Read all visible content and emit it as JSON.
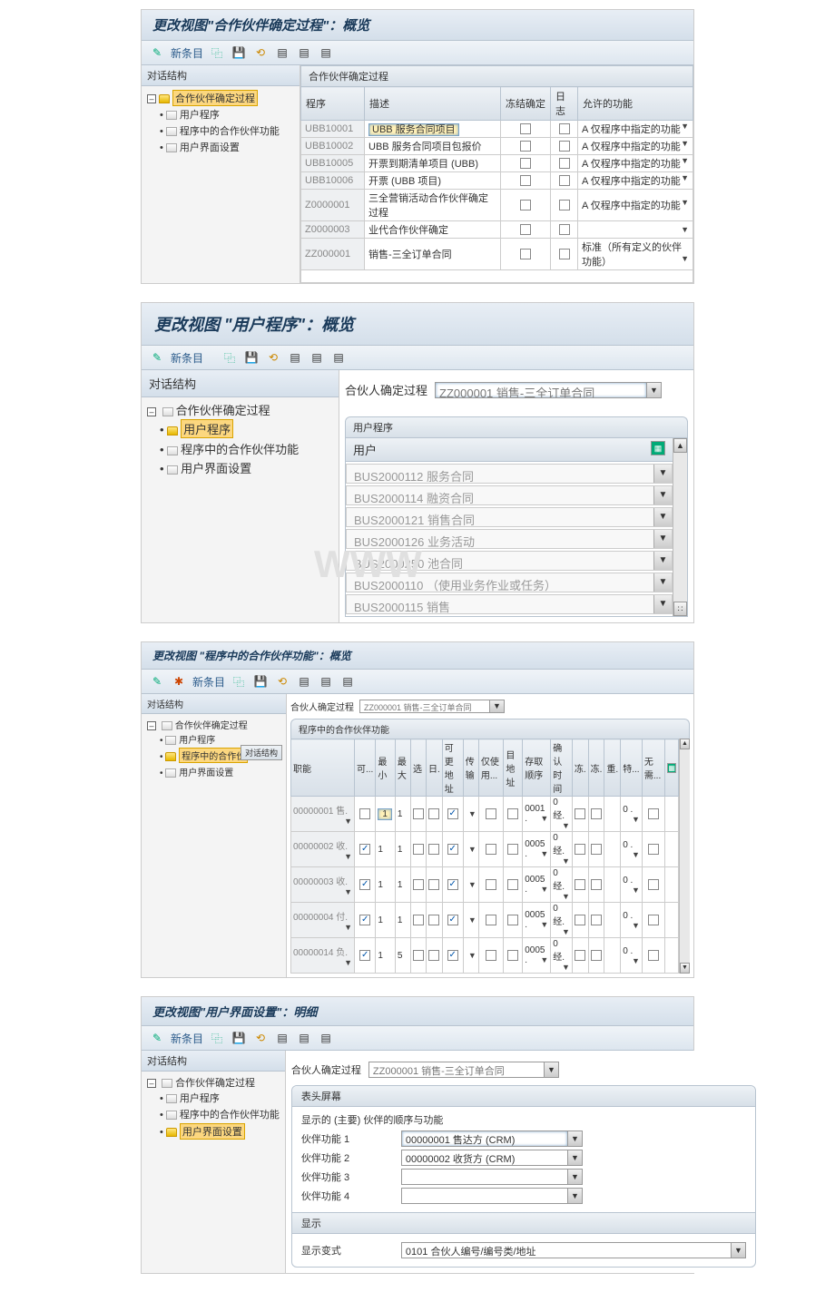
{
  "panel1": {
    "title": "更改视图\"合作伙伴确定过程\"：概览",
    "toolbar_new": "新条目",
    "sidebar_head": "对话结构",
    "tree_root": "合作伙伴确定过程",
    "tree_items": [
      "用户程序",
      "程序中的合作伙伴功能",
      "用户界面设置"
    ],
    "grid_title": "合作伙伴确定过程",
    "columns": {
      "c1": "程序",
      "c2": "描述",
      "c3": "冻结确定",
      "c4": "日志",
      "c5": "允许的功能"
    },
    "rows": [
      {
        "code": "UBB10001",
        "desc": "UBB 服务合同项目",
        "func": "A 仅程序中指定的功能",
        "hl": true
      },
      {
        "code": "UBB10002",
        "desc": "UBB 服务合同项目包报价",
        "func": "A 仅程序中指定的功能"
      },
      {
        "code": "UBB10005",
        "desc": "开票到期清单项目 (UBB)",
        "func": "A 仅程序中指定的功能"
      },
      {
        "code": "UBB10006",
        "desc": "开票 (UBB 项目)",
        "func": "A 仅程序中指定的功能"
      },
      {
        "code": "Z0000001",
        "desc": "三全营销活动合作伙伴确定过程",
        "func": "A 仅程序中指定的功能"
      },
      {
        "code": "Z0000003",
        "desc": "业代合作伙伴确定",
        "func": ""
      },
      {
        "code": "ZZ000001",
        "desc": "销售-三全订单合同",
        "func": "标准（所有定义的伙伴功能）"
      }
    ]
  },
  "panel2": {
    "title": "更改视图 \"用户程序\"：概览",
    "toolbar_new": "新条目",
    "sidebar_head": "对话结构",
    "tree_root": "合作伙伴确定过程",
    "tree_items": [
      "用户程序",
      "程序中的合作伙伴功能",
      "用户界面设置"
    ],
    "proc_label": "合伙人确定过程",
    "proc_value": "ZZ000001 销售-三全订单合同",
    "grid_title": "用户程序",
    "user_col": "用户",
    "users": [
      "BUS2000112  服务合同",
      "BUS2000114  融资合同",
      "BUS2000121  销售合同",
      "BUS2000126  业务活动",
      "BUS2000250  池合同",
      "BUS2000110 （使用业务作业或任务）",
      "BUS2000115  销售"
    ]
  },
  "panel3": {
    "title": "更改视图 \"程序中的合作伙伴功能\"：概览",
    "toolbar_new": "新条目",
    "sidebar_head": "对话结构",
    "sb_tab": "对话结构",
    "tree_root": "合作伙伴确定过程",
    "tree_items": [
      "用户程序",
      "程序中的合作伙",
      "用户界面设置"
    ],
    "proc_label": "合伙人确定过程",
    "proc_value": "ZZ000001 销售-三全订单合同",
    "grid_title": "程序中的合作伙伴功能",
    "cols": [
      "职能",
      "可...",
      "最小",
      "最大",
      "选",
      "日.",
      "可更地址",
      "传输",
      "仅使用...",
      "目地址",
      "存取顺序",
      "确认时间",
      "冻.",
      "冻.",
      "重.",
      "特...",
      "无需..."
    ],
    "rows": [
      {
        "fn": "00000001 售.",
        "min": "1",
        "max": "1",
        "seq": "0001",
        "conf": "0 经."
      },
      {
        "fn": "00000002 收.",
        "chk": true,
        "min": "1",
        "max": "1",
        "seq": "0005",
        "conf": "0 经."
      },
      {
        "fn": "00000003 收.",
        "chk": true,
        "min": "1",
        "max": "1",
        "seq": "0005",
        "conf": "0 经."
      },
      {
        "fn": "00000004 付.",
        "chk": true,
        "min": "1",
        "max": "1",
        "seq": "0005",
        "conf": "0 经."
      },
      {
        "fn": "00000014 负.",
        "chk": true,
        "min": "1",
        "max": "5",
        "seq": "0005",
        "conf": "0 经."
      }
    ],
    "sp_val": "0 ."
  },
  "panel4": {
    "title": "更改视图\"用户界面设置\"：明细",
    "toolbar_new": "新条目",
    "sidebar_head": "对话结构",
    "tree_root": "合作伙伴确定过程",
    "tree_items": [
      "用户程序",
      "程序中的合作伙伴功能",
      "用户界面设置"
    ],
    "proc_label": "合伙人确定过程",
    "proc_value": "ZZ000001 销售-三全订单合同",
    "box1_title": "表头屏幕",
    "box1_sub": "显示的 (主要) 伙伴的顺序与功能",
    "pf": [
      "伙伴功能 1",
      "伙伴功能 2",
      "伙伴功能 3",
      "伙伴功能 4"
    ],
    "pf_vals": [
      "00000001 售达方 (CRM)",
      "00000002 收货方 (CRM)",
      "",
      ""
    ],
    "box2_title": "显示",
    "disp_label": "显示变式",
    "disp_value": "0101 合伙人编号/编号类/地址"
  }
}
